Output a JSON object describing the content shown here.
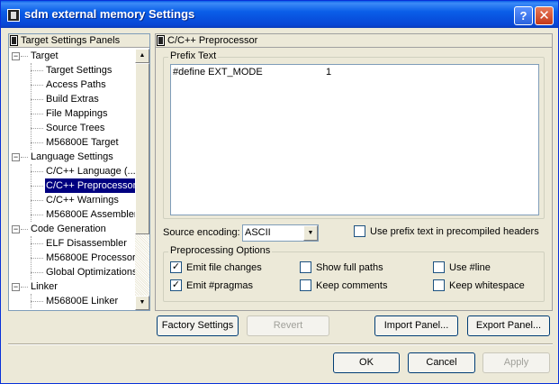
{
  "window": {
    "title": "sdm external memory Settings",
    "help_label": "?",
    "close_label": "✕"
  },
  "left_panel": {
    "header": "Target Settings Panels",
    "tree": [
      {
        "type": "category",
        "label": "Target",
        "expander": "−"
      },
      {
        "type": "leaf",
        "label": "Target Settings"
      },
      {
        "type": "leaf",
        "label": "Access Paths"
      },
      {
        "type": "leaf",
        "label": "Build Extras"
      },
      {
        "type": "leaf",
        "label": "File Mappings"
      },
      {
        "type": "leaf",
        "label": "Source Trees"
      },
      {
        "type": "leaf",
        "label": "M56800E Target"
      },
      {
        "type": "category",
        "label": "Language Settings",
        "expander": "−"
      },
      {
        "type": "leaf",
        "label": "C/C++ Language (..."
      },
      {
        "type": "leaf",
        "label": "C/C++ Preprocessor",
        "selected": true
      },
      {
        "type": "leaf",
        "label": "C/C++ Warnings"
      },
      {
        "type": "leaf",
        "label": "M56800E Assembler"
      },
      {
        "type": "category",
        "label": "Code Generation",
        "expander": "−"
      },
      {
        "type": "leaf",
        "label": "ELF Disassembler"
      },
      {
        "type": "leaf",
        "label": "M56800E Processor"
      },
      {
        "type": "leaf",
        "label": "Global Optimizations"
      },
      {
        "type": "category",
        "label": "Linker",
        "expander": "−"
      },
      {
        "type": "leaf",
        "label": "M56800E Linker"
      }
    ],
    "scroll_up": "▲",
    "scroll_down": "▼"
  },
  "right_panel": {
    "header": "C/C++ Preprocessor",
    "prefix_group_title": "Prefix Text",
    "prefix_define": "#define EXT_MODE",
    "prefix_value": "1",
    "source_encoding_label": "Source encoding:",
    "source_encoding_value": "ASCII",
    "use_prefix_label": "Use prefix text in precompiled headers",
    "use_prefix_checked": false,
    "options_group_title": "Preprocessing Options",
    "options": {
      "emit_file_changes": {
        "label": "Emit file changes",
        "checked": true
      },
      "show_full_paths": {
        "label": "Show full paths",
        "checked": false
      },
      "use_line": {
        "label": "Use #line",
        "checked": false
      },
      "emit_pragmas": {
        "label": "Emit #pragmas",
        "checked": true
      },
      "keep_comments": {
        "label": "Keep comments",
        "checked": false
      },
      "keep_whitespace": {
        "label": "Keep whitespace",
        "checked": false
      }
    }
  },
  "panel_buttons": {
    "factory_settings": "Factory Settings",
    "revert": "Revert",
    "import_panel": "Import Panel...",
    "export_panel": "Export Panel..."
  },
  "dialog_buttons": {
    "ok": "OK",
    "cancel": "Cancel",
    "apply": "Apply"
  },
  "colors": {
    "title_bar": "#0a5ee8",
    "selection": "#000080",
    "dialog_face": "#ece9d8"
  }
}
